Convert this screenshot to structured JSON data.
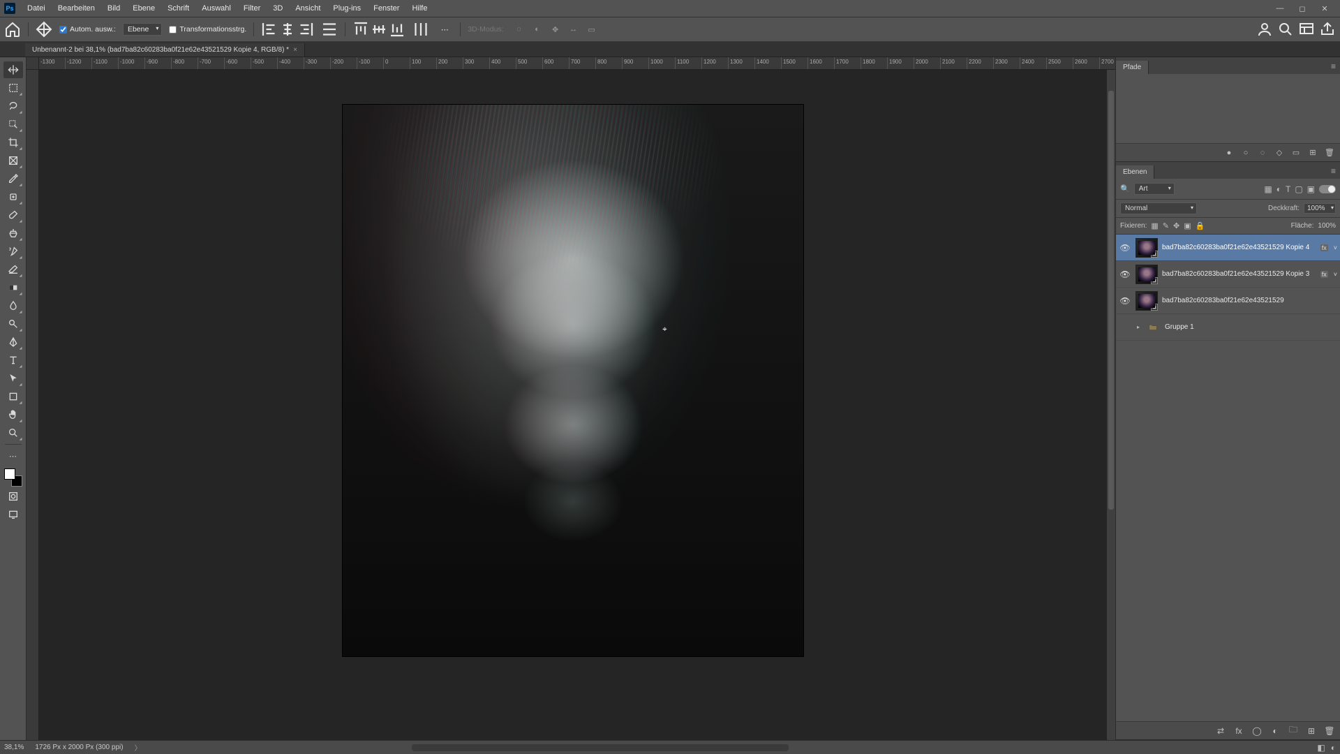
{
  "menu": {
    "items": [
      "Datei",
      "Bearbeiten",
      "Bild",
      "Ebene",
      "Schrift",
      "Auswahl",
      "Filter",
      "3D",
      "Ansicht",
      "Plug-ins",
      "Fenster",
      "Hilfe"
    ]
  },
  "options": {
    "auto_select_label": "Autom. ausw.:",
    "auto_select_target": "Ebene",
    "transform_label": "Transformationsstrg.",
    "mode_label": "3D-Modus:"
  },
  "document": {
    "tab_title": "Unbenannt-2 bei 38,1% (bad7ba82c60283ba0f21e62e43521529 Kopie 4, RGB/8) *"
  },
  "ruler": {
    "h_ticks": [
      "-1300",
      "-1200",
      "-1100",
      "-1000",
      "-900",
      "-800",
      "-700",
      "-600",
      "-500",
      "-400",
      "-300",
      "-200",
      "-100",
      "0",
      "100",
      "200",
      "300",
      "400",
      "500",
      "600",
      "700",
      "800",
      "900",
      "1000",
      "1100",
      "1200",
      "1300",
      "1400",
      "1500",
      "1600",
      "1700",
      "1800",
      "1900",
      "2000",
      "2100",
      "2200",
      "2300",
      "2400",
      "2500",
      "2600",
      "2700"
    ]
  },
  "paths_panel": {
    "tab": "Pfade"
  },
  "layers_panel": {
    "tab": "Ebenen",
    "filter_kind": "Art",
    "blend_mode": "Normal",
    "opacity_label": "Deckkraft:",
    "opacity_value": "100%",
    "lock_label": "Fixieren:",
    "fill_label": "Fläche:",
    "fill_value": "100%",
    "layers": [
      {
        "visible": true,
        "name": "bad7ba82c60283ba0f21e62e43521529 Kopie 4",
        "selected": true,
        "smart": true,
        "has_fx": true
      },
      {
        "visible": true,
        "name": "bad7ba82c60283ba0f21e62e43521529 Kopie 3",
        "selected": false,
        "smart": true,
        "has_fx": true
      },
      {
        "visible": true,
        "name": "bad7ba82c60283ba0f21e62e43521529",
        "selected": false,
        "smart": true,
        "has_fx": false
      },
      {
        "visible": false,
        "name": "Gruppe 1",
        "selected": false,
        "is_group": true
      }
    ]
  },
  "status": {
    "zoom": "38,1%",
    "doc_info": "1726 Px x 2000 Px (300 ppi)"
  }
}
